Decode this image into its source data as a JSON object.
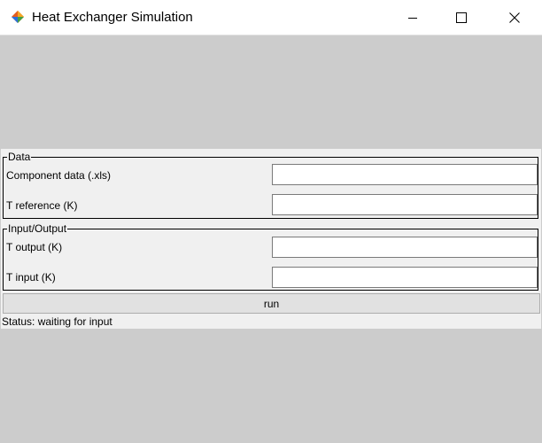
{
  "window": {
    "title": "Heat Exchanger Simulation",
    "controls": {
      "minimize_icon": "minimize-icon",
      "maximize_icon": "maximize-icon",
      "close_icon": "close-icon"
    }
  },
  "data_group": {
    "legend": "Data",
    "fields": [
      {
        "label": "Component data (.xls)",
        "value": "",
        "placeholder": ""
      },
      {
        "label": "T reference (K)",
        "value": "",
        "placeholder": ""
      }
    ]
  },
  "io_group": {
    "legend": "Input/Output",
    "fields": [
      {
        "label": "T output (K)",
        "value": "",
        "placeholder": ""
      },
      {
        "label": "T input (K)",
        "value": "",
        "placeholder": ""
      }
    ]
  },
  "run_button": {
    "label": "run"
  },
  "status": {
    "text": "Status: waiting for input"
  },
  "colors": {
    "background": "#cccccc",
    "panel": "#f0f0f0",
    "titlebar": "#ffffff"
  }
}
